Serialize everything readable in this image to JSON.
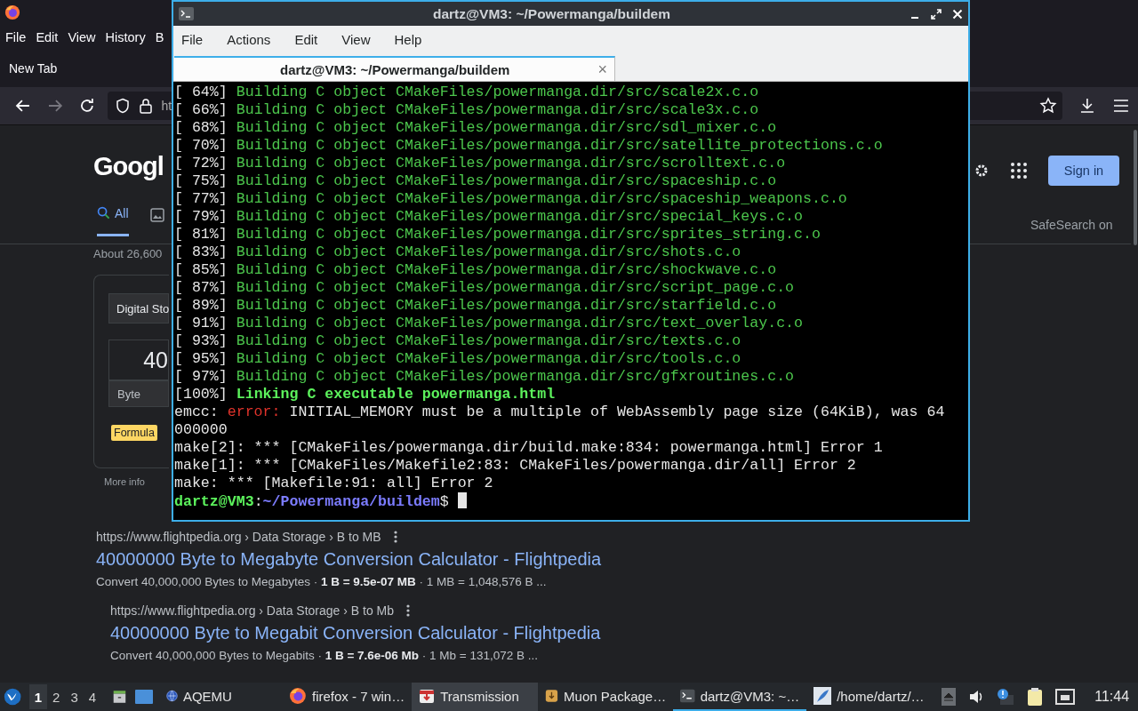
{
  "browser": {
    "menu": [
      "File",
      "Edit",
      "View",
      "History",
      "B"
    ],
    "tab": "New Tab",
    "url": "ht",
    "logo": "Googl",
    "search_tabs": [
      {
        "label": "All",
        "selected": true
      }
    ],
    "result_stats": "About 26,600",
    "converter": {
      "category": "Digital Sto",
      "value": "40",
      "unit": "Byte",
      "badge": "Formula",
      "more": "More info"
    },
    "sign_in": "Sign in",
    "safesearch": "SafeSearch on",
    "results": [
      {
        "url": "https://www.flightpedia.org › Data Storage › B to MB",
        "title": "40000000 Byte to Megabyte Conversion Calculator - Flightpedia",
        "snippet": "Convert 40,000,000 Bytes to Megabytes · **1 B = 9.5e-07 MB** · 1 MB = 1,048,576 B ...",
        "children": [
          {
            "url": "https://www.flightpedia.org › Data Storage › B to Mb",
            "title": "40000000 Byte to Megabit Conversion Calculator - Flightpedia",
            "snippet": "Convert 40,000,000 Bytes to Megabits · **1 B = 7.6e-06 Mb** · 1 Mb = 131,072 B ..."
          }
        ]
      }
    ]
  },
  "terminal": {
    "title": "dartz@VM3: ~/Powermanga/buildem",
    "menu": [
      "File",
      "Actions",
      "Edit",
      "View",
      "Help"
    ],
    "tab": "dartz@VM3: ~/Powermanga/buildem",
    "tab_close": "×",
    "lines": [
      [
        {
          "kind": "plain",
          "text": "[ 64%] "
        },
        {
          "kind": "build",
          "text": "Building C object CMakeFiles/powermanga.dir/src/scale2x.c.o"
        }
      ],
      [
        {
          "kind": "plain",
          "text": "[ 66%] "
        },
        {
          "kind": "build",
          "text": "Building C object CMakeFiles/powermanga.dir/src/scale3x.c.o"
        }
      ],
      [
        {
          "kind": "plain",
          "text": "[ 68%] "
        },
        {
          "kind": "build",
          "text": "Building C object CMakeFiles/powermanga.dir/src/sdl_mixer.c.o"
        }
      ],
      [
        {
          "kind": "plain",
          "text": "[ 70%] "
        },
        {
          "kind": "build",
          "text": "Building C object CMakeFiles/powermanga.dir/src/satellite_protections.c.o"
        }
      ],
      [
        {
          "kind": "plain",
          "text": "[ 72%] "
        },
        {
          "kind": "build",
          "text": "Building C object CMakeFiles/powermanga.dir/src/scrolltext.c.o"
        }
      ],
      [
        {
          "kind": "plain",
          "text": "[ 75%] "
        },
        {
          "kind": "build",
          "text": "Building C object CMakeFiles/powermanga.dir/src/spaceship.c.o"
        }
      ],
      [
        {
          "kind": "plain",
          "text": "[ 77%] "
        },
        {
          "kind": "build",
          "text": "Building C object CMakeFiles/powermanga.dir/src/spaceship_weapons.c.o"
        }
      ],
      [
        {
          "kind": "plain",
          "text": "[ 79%] "
        },
        {
          "kind": "build",
          "text": "Building C object CMakeFiles/powermanga.dir/src/special_keys.c.o"
        }
      ],
      [
        {
          "kind": "plain",
          "text": "[ 81%] "
        },
        {
          "kind": "build",
          "text": "Building C object CMakeFiles/powermanga.dir/src/sprites_string.c.o"
        }
      ],
      [
        {
          "kind": "plain",
          "text": "[ 83%] "
        },
        {
          "kind": "build",
          "text": "Building C object CMakeFiles/powermanga.dir/src/shots.c.o"
        }
      ],
      [
        {
          "kind": "plain",
          "text": "[ 85%] "
        },
        {
          "kind": "build",
          "text": "Building C object CMakeFiles/powermanga.dir/src/shockwave.c.o"
        }
      ],
      [
        {
          "kind": "plain",
          "text": "[ 87%] "
        },
        {
          "kind": "build",
          "text": "Building C object CMakeFiles/powermanga.dir/src/script_page.c.o"
        }
      ],
      [
        {
          "kind": "plain",
          "text": "[ 89%] "
        },
        {
          "kind": "build",
          "text": "Building C object CMakeFiles/powermanga.dir/src/starfield.c.o"
        }
      ],
      [
        {
          "kind": "plain",
          "text": "[ 91%] "
        },
        {
          "kind": "build",
          "text": "Building C object CMakeFiles/powermanga.dir/src/text_overlay.c.o"
        }
      ],
      [
        {
          "kind": "plain",
          "text": "[ 93%] "
        },
        {
          "kind": "build",
          "text": "Building C object CMakeFiles/powermanga.dir/src/texts.c.o"
        }
      ],
      [
        {
          "kind": "plain",
          "text": "[ 95%] "
        },
        {
          "kind": "build",
          "text": "Building C object CMakeFiles/powermanga.dir/src/tools.c.o"
        }
      ],
      [
        {
          "kind": "plain",
          "text": "[ 97%] "
        },
        {
          "kind": "build",
          "text": "Building C object CMakeFiles/powermanga.dir/src/gfxroutines.c.o"
        }
      ],
      [
        {
          "kind": "plain",
          "text": "[100%] "
        },
        {
          "kind": "link",
          "text": "Linking C executable powermanga.html"
        }
      ],
      [
        {
          "kind": "plain",
          "text": "emcc: "
        },
        {
          "kind": "error",
          "text": "error:"
        },
        {
          "kind": "plain",
          "text": " INITIAL_MEMORY must be a multiple of WebAssembly page size (64KiB), was 64"
        }
      ],
      [
        {
          "kind": "plain",
          "text": "000000"
        }
      ],
      [
        {
          "kind": "plain",
          "text": "make[2]: *** [CMakeFiles/powermanga.dir/build.make:834: powermanga.html] Error 1"
        }
      ],
      [
        {
          "kind": "plain",
          "text": "make[1]: *** [CMakeFiles/Makefile2:83: CMakeFiles/powermanga.dir/all] Error 2"
        }
      ],
      [
        {
          "kind": "plain",
          "text": "make: *** [Makefile:91: all] Error 2"
        }
      ],
      [
        {
          "kind": "user",
          "text": "dartz@VM3"
        },
        {
          "kind": "plain",
          "text": ":"
        },
        {
          "kind": "path",
          "text": "~/Powermanga/buildem"
        },
        {
          "kind": "plain",
          "text": "$ "
        },
        {
          "kind": "cursor"
        }
      ]
    ]
  },
  "taskbar": {
    "workspaces": [
      {
        "label": "1",
        "selected": true
      },
      {
        "label": "2",
        "selected": false
      },
      {
        "label": "3",
        "selected": false
      },
      {
        "label": "4",
        "selected": false
      }
    ],
    "tasks": [
      {
        "label": "AQEMU",
        "selected": false,
        "hovered": false
      },
      {
        "label": "firefox - 7 win…",
        "selected": false,
        "hovered": false
      },
      {
        "label": "Transmission",
        "selected": false,
        "hovered": true
      },
      {
        "label": "Muon Package…",
        "selected": false,
        "hovered": false
      },
      {
        "label": "dartz@VM3: ~…",
        "selected": true,
        "hovered": false
      },
      {
        "label": "/home/dartz/…",
        "selected": false,
        "hovered": false
      }
    ],
    "clock": "11:44"
  }
}
